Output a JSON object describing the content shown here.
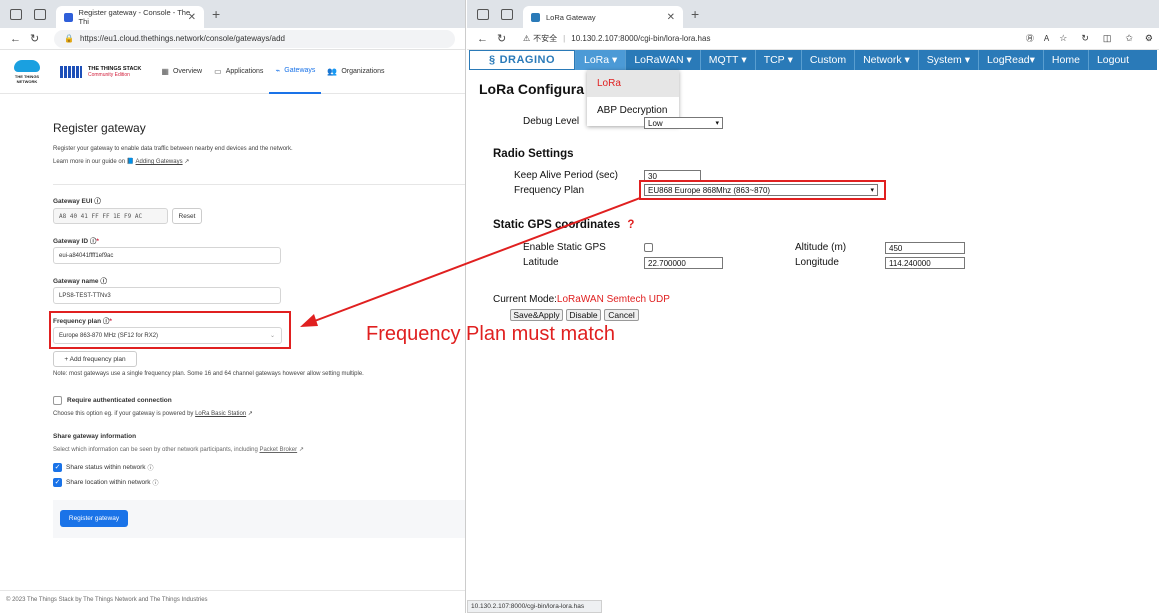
{
  "left": {
    "tab_title": "Register gateway - Console - The Thi",
    "url": "https://eu1.cloud.thethings.network/console/gateways/add",
    "logo_ttn": "THE THINGS NETWORK",
    "stack_title": "THE THINGS STACK",
    "stack_sub": "Community Edition",
    "nav": [
      "Overview",
      "Applications",
      "Gateways",
      "Organizations"
    ],
    "page_title": "Register gateway",
    "intro": "Register your gateway to enable data traffic between nearby end devices and the network.",
    "guide_prefix": "Learn more in our guide on",
    "guide_link": "Adding Gateways",
    "eui_label": "Gateway EUI",
    "eui_value": "A8 40 41 FF FF 1E F9 AC",
    "reset_label": "Reset",
    "id_label": "Gateway ID",
    "id_value": "eui-a84041ffff1ef9ac",
    "name_label": "Gateway name",
    "name_value": "LPS8-TEST-TTNv3",
    "fp_label": "Frequency plan",
    "fp_value": "Europe 863-870 MHz (SF12 for RX2)",
    "add_fp": "+ Add frequency plan",
    "fp_note": "Note: most gateways use a single frequency plan. Some 16 and 64 channel gateways however allow setting multiple.",
    "auth_label": "Require authenticated connection",
    "auth_note_prefix": "Choose this option eg. if your gateway is powered by",
    "auth_link": "LoRa Basic Station",
    "share_title": "Share gateway information",
    "share_note_prefix": "Select which information can be seen by other network participants, including",
    "share_link": "Packet Broker",
    "share_status": "Share status within network",
    "share_location": "Share location within network",
    "register_btn": "Register gateway",
    "footer": "© 2023 The Things Stack by The Things Network and The Things Industries"
  },
  "right": {
    "tab_title": "LoRa Gateway",
    "insecure": "不安全",
    "url": "10.130.2.107:8000/cgi-bin/lora-lora.has",
    "brand": "DRAGINO",
    "menu": [
      "LoRa",
      "LoRaWAN",
      "MQTT",
      "TCP",
      "Custom",
      "Network",
      "System",
      "LogRead",
      "Home",
      "Logout"
    ],
    "dropdown": [
      "LoRa",
      "ABP Decryption"
    ],
    "page_title": "LoRa Configura",
    "debug_label": "Debug Level",
    "debug_value": "Low",
    "radio_title": "Radio Settings",
    "keepalive_label": "Keep Alive Period (sec)",
    "keepalive_value": "30",
    "fp_label": "Frequency Plan",
    "fp_value": "EU868 Europe 868Mhz (863~870)",
    "gps_title": "Static GPS coordinates",
    "gps_help": "?",
    "enable_gps": "Enable Static GPS",
    "altitude_label": "Altitude (m)",
    "altitude_value": "450",
    "latitude_label": "Latitude",
    "latitude_value": "22.700000",
    "longitude_label": "Longitude",
    "longitude_value": "114.240000",
    "mode_label": "Current Mode:",
    "mode_value": "LoRaWAN Semtech UDP",
    "save_btn": "Save&Apply",
    "disable_btn": "Disable",
    "cancel_btn": "Cancel",
    "status_url": "10.130.2.107:8000/cgi-bin/lora-lora.has"
  },
  "annotation": "Frequency Plan must match",
  "colors": {
    "ttn_blue": "#1a73e8",
    "dragino_blue": "#2a7ab8",
    "annotation_red": "#e02020"
  }
}
